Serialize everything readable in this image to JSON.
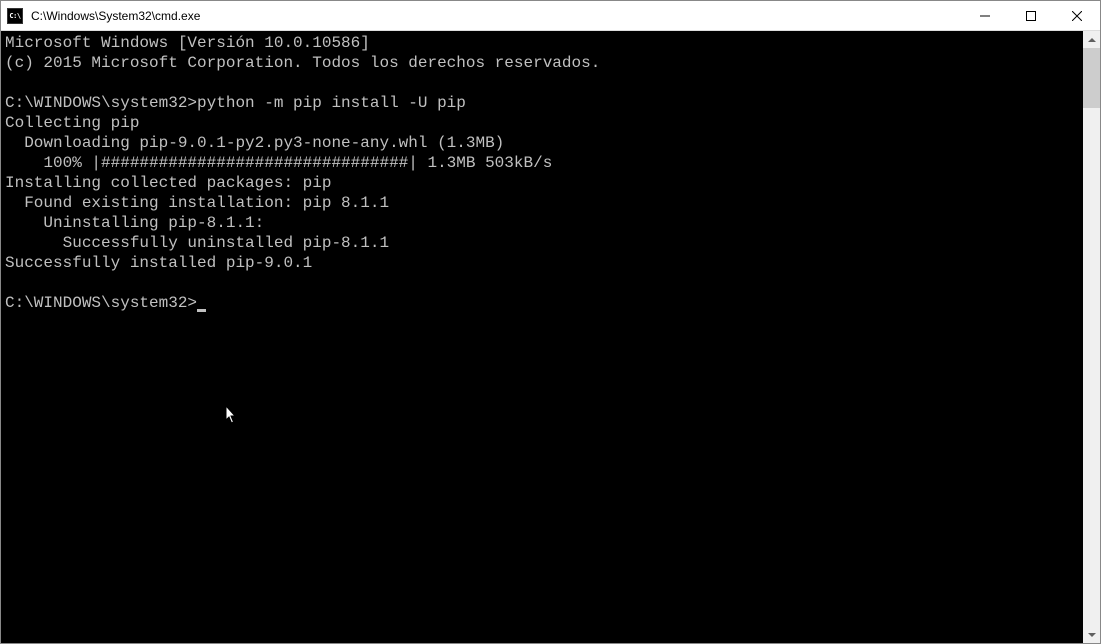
{
  "window": {
    "icon_text": "C:\\",
    "title": "C:\\Windows\\System32\\cmd.exe"
  },
  "terminal": {
    "lines": [
      "Microsoft Windows [Versión 10.0.10586]",
      "(c) 2015 Microsoft Corporation. Todos los derechos reservados.",
      "",
      "C:\\WINDOWS\\system32>python -m pip install -U pip",
      "Collecting pip",
      "  Downloading pip-9.0.1-py2.py3-none-any.whl (1.3MB)",
      "    100% |################################| 1.3MB 503kB/s",
      "Installing collected packages: pip",
      "  Found existing installation: pip 8.1.1",
      "    Uninstalling pip-8.1.1:",
      "      Successfully uninstalled pip-8.1.1",
      "Successfully installed pip-9.0.1",
      "",
      "C:\\WINDOWS\\system32>"
    ]
  }
}
